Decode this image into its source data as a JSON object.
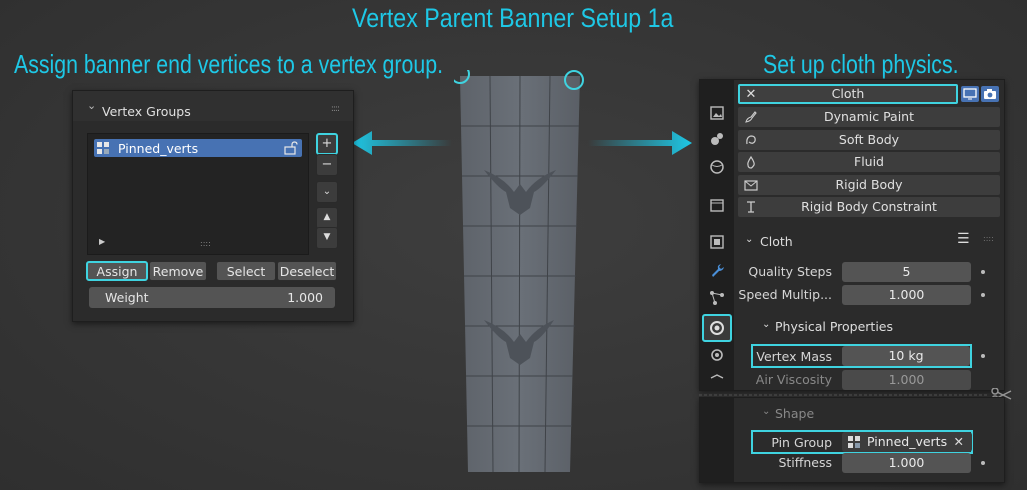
{
  "annotations": {
    "title": "Vertex Parent Banner Setup 1a",
    "left_caption": "Assign banner end vertices to a vertex group.",
    "right_caption": "Set up cloth physics."
  },
  "colors": {
    "accent": "#1ec8e6",
    "selection": "#4772b3",
    "panel": "#303030"
  },
  "vertex_groups": {
    "title": "Vertex Groups",
    "items": [
      {
        "name": "Pinned_verts"
      }
    ],
    "side_buttons": {
      "add": "+",
      "remove": "−"
    },
    "assign_label": "Assign",
    "remove_label": "Remove",
    "select_label": "Select",
    "deselect_label": "Deselect",
    "weight_label": "Weight",
    "weight_value": "1.000"
  },
  "physics": {
    "buttons": [
      {
        "label": "Cloth",
        "active": true,
        "icon": "close-icon"
      },
      {
        "label": "Dynamic Paint",
        "icon": "brush-icon"
      },
      {
        "label": "Soft Body",
        "icon": "soft-body-icon"
      },
      {
        "label": "Fluid",
        "icon": "drop-icon"
      },
      {
        "label": "Rigid Body",
        "icon": "rigid-body-icon"
      },
      {
        "label": "Rigid Body Constraint",
        "icon": "constraint-icon"
      }
    ],
    "cloth_section": "Cloth",
    "quality_label": "Quality Steps",
    "quality_value": "5",
    "speed_label": "Speed Multip...",
    "speed_value": "1.000",
    "physical_section": "Physical Properties",
    "mass_label": "Vertex Mass",
    "mass_value": "10 kg",
    "air_label": "Air Viscosity",
    "air_value": "1.000",
    "shape_section": "Shape",
    "pin_label": "Pin Group",
    "pin_value": "Pinned_verts",
    "stiffness_label": "Stiffness",
    "stiffness_value": "1.000"
  }
}
